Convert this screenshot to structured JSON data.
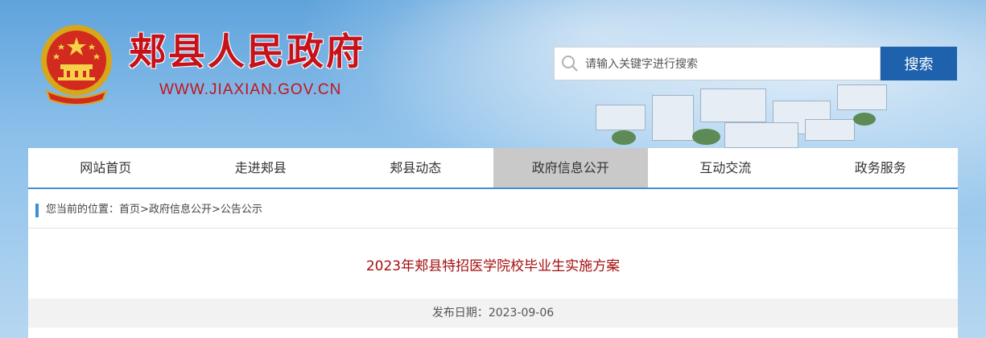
{
  "header": {
    "site_title": "郏县人民政府",
    "site_url": "WWW.JIAXIAN.GOV.CN"
  },
  "search": {
    "placeholder": "请输入关键字进行搜索",
    "value": "",
    "button_label": "搜索"
  },
  "nav": {
    "items": [
      {
        "label": "网站首页"
      },
      {
        "label": "走进郏县"
      },
      {
        "label": "郏县动态"
      },
      {
        "label": "政府信息公开",
        "active": true
      },
      {
        "label": "互动交流"
      },
      {
        "label": "政务服务"
      }
    ]
  },
  "breadcrumb": {
    "prefix": "您当前的位置：",
    "items": [
      "首页",
      "政府信息公开",
      "公告公示"
    ],
    "separator": ">"
  },
  "article": {
    "title": "2023年郏县特招医学院校毕业生实施方案",
    "date_label": "发布日期：",
    "date": "2023-09-06"
  },
  "colors": {
    "brand_red": "#c6121b",
    "title_red": "#a50e0e",
    "accent_blue": "#1e62ad",
    "nav_active_bg": "#c9c9c9"
  },
  "icons": {
    "emblem": "national-emblem-icon",
    "search": "search-icon"
  }
}
